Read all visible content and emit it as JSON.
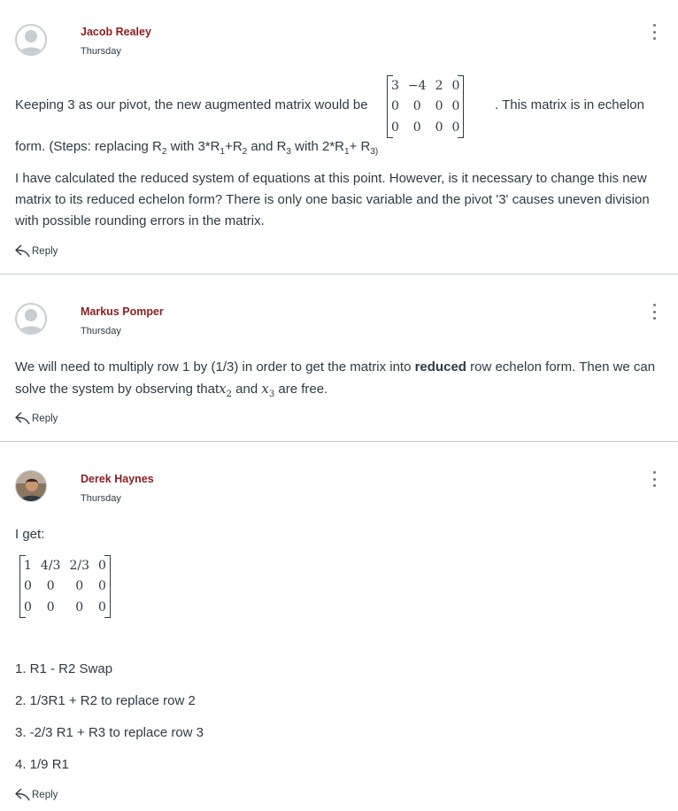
{
  "posts": [
    {
      "author": "Jacob Realey",
      "date": "Thursday",
      "text_before_matrix": "Keeping 3 as our pivot, the new augmented matrix would be",
      "text_after_matrix": ". This matrix is in echelon",
      "matrix": [
        [
          "3",
          "−4",
          "2",
          "0"
        ],
        [
          "0",
          "0",
          "0",
          "0"
        ],
        [
          "0",
          "0",
          "0",
          "0"
        ]
      ],
      "steps_line": {
        "t1": "form. (Steps: replacing R",
        "s1": "2",
        "t2": " with 3*R",
        "s2": "1",
        "t3": "+R",
        "s3": "2",
        "t4": " and R",
        "s4": "3",
        "t5": " with 2*R",
        "s5": "1",
        "t6": "+ R",
        "s6": "3)"
      },
      "paragraph": "I have calculated the reduced system of equations at this point. However, is it necessary to change this new matrix to its reduced echelon form? There is only one basic variable and the pivot '3' causes uneven division with possible rounding errors in the matrix.",
      "reply_label": "Reply"
    },
    {
      "author": "Markus Pomper",
      "date": "Thursday",
      "p1": "We will need to multiply row 1 by (1/3) in order to get the matrix into ",
      "bold": "reduced",
      "p2": " row echelon form. Then we can solve the system by observing that",
      "var1": "x",
      "var1_sub": "2",
      "p3": " and ",
      "var2": "x",
      "var2_sub": "3",
      "p4": " are free.",
      "reply_label": "Reply"
    },
    {
      "author": "Derek Haynes",
      "date": "Thursday",
      "intro": "I get:",
      "matrix": [
        [
          "1",
          "4/3",
          "2/3",
          "0"
        ],
        [
          "0",
          "0",
          "0",
          "0"
        ],
        [
          "0",
          "0",
          "0",
          "0"
        ]
      ],
      "steps": [
        "1.  R1 - R2 Swap",
        "2. 1/3R1 + R2 to replace row 2",
        "3. -2/3 R1 + R3 to replace row 3",
        "4. 1/9 R1"
      ],
      "reply_label": "Reply"
    }
  ],
  "icons": {
    "avatar_placeholder": "user-silhouette",
    "more": "kebab-menu",
    "reply": "reply-arrow"
  },
  "colors": {
    "author": "#8b1e1e",
    "text": "#2d3b45",
    "divider": "#c7cdd1"
  }
}
